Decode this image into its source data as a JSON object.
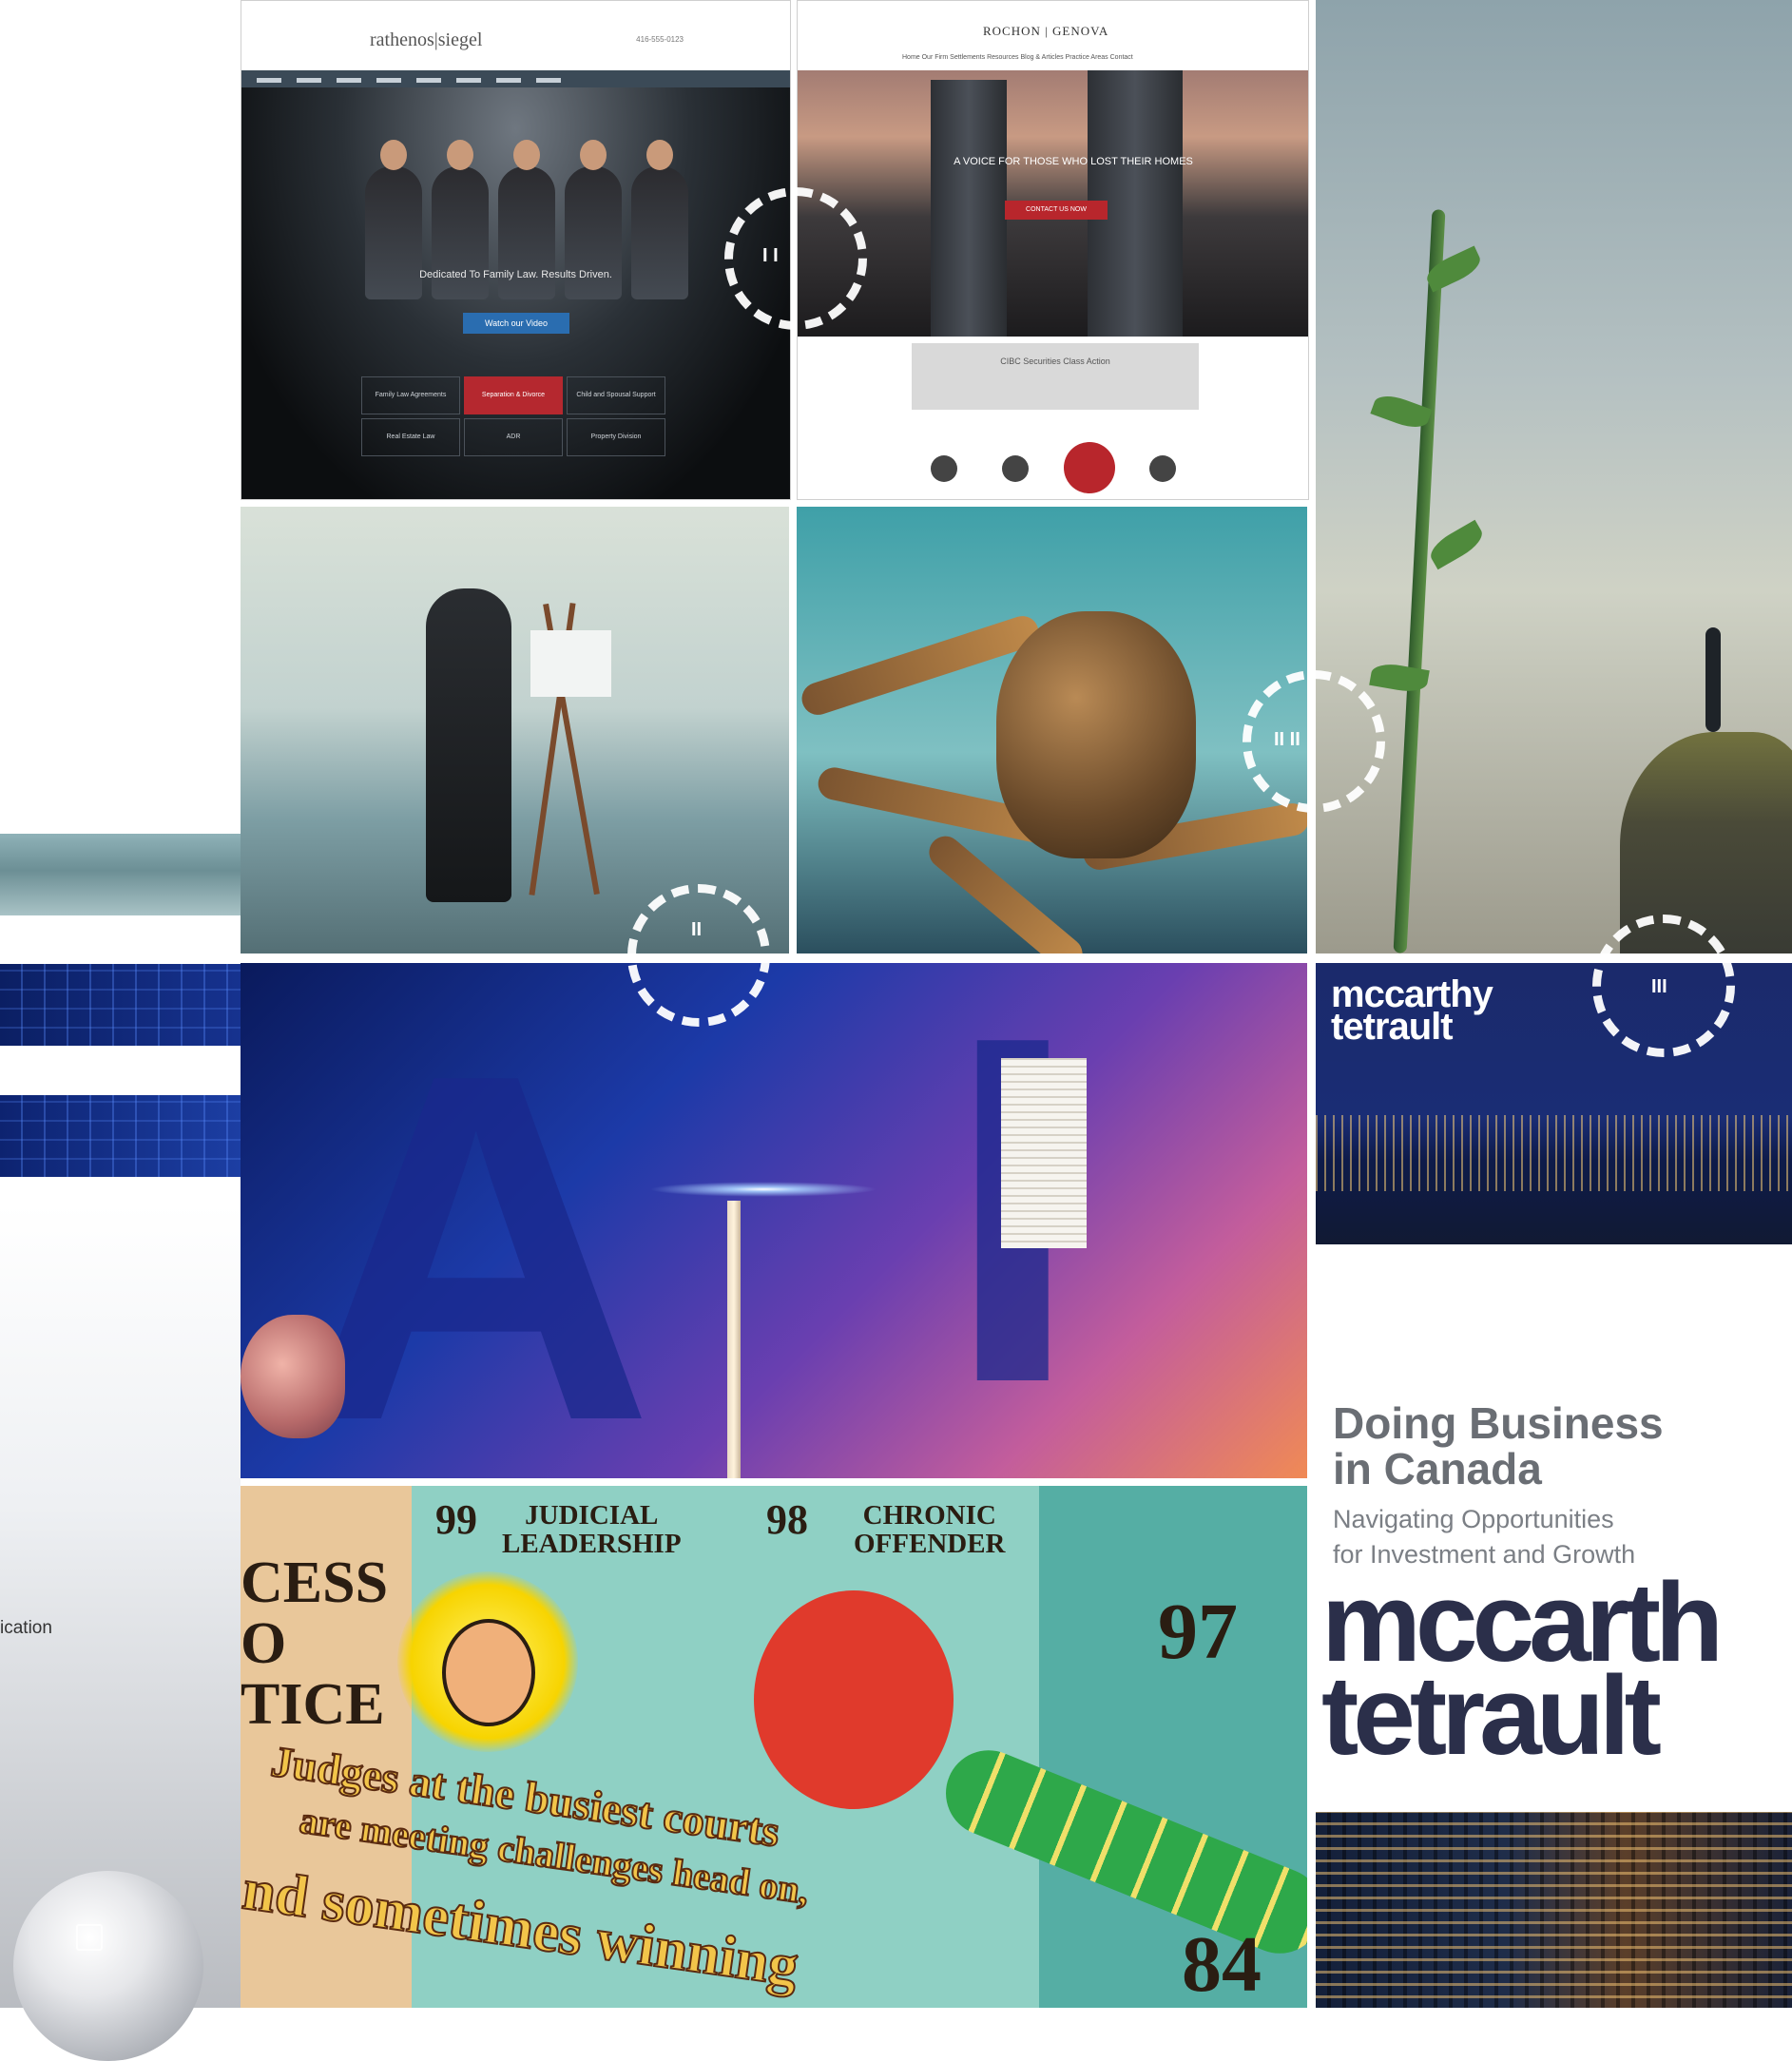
{
  "side_caption": "ication",
  "site_one": {
    "logo": "rathenos|siegel",
    "phone": "416-555-0123",
    "tagline": "Dedicated To Family Law. Results Driven.",
    "cta": "Watch our Video",
    "services": [
      "Family Law Agreements",
      "Separation & Divorce",
      "Child and Spousal Support",
      "Real Estate Law",
      "ADR",
      "Property Division"
    ]
  },
  "site_two": {
    "logo": "ROCHON | GENOVA",
    "nav": "Home  Our Firm  Settlements  Resources  Blog & Articles  Practice Areas  Contact",
    "heading": "A VOICE FOR THOSE WHO LOST THEIR HOMES",
    "cta": "CONTACT US NOW",
    "notice_title": "CIBC Securities Class Action"
  },
  "mccarthy": {
    "logo_line1": "mccarthy",
    "logo_line2": "tetrault"
  },
  "cover": {
    "title_line1": "Doing Business",
    "title_line2": "in Canada",
    "subtitle_line1": "Navigating Opportunities",
    "subtitle_line2": "for Investment and Growth",
    "logo_line1": "mccarth",
    "logo_line2": "tetrault"
  },
  "comic": {
    "access_lines": [
      "CESS",
      "O",
      "TICE"
    ],
    "num_99": "99",
    "label_99_line1": "JUDICIAL",
    "label_99_line2": "LEADERSHIP",
    "num_98": "98",
    "label_98_line1": "CHRONIC",
    "label_98_line2": "OFFENDER",
    "num_97": "97",
    "num_84": "84",
    "caption_line1": "Judges at the busiest courts",
    "caption_line2": "are meeting challenges head on,",
    "caption_line3": "nd sometimes winning"
  },
  "play_marks": {
    "one": "I    I",
    "two": "II",
    "three": "II    II",
    "four": "III"
  },
  "colors": {
    "accent_red": "#b5282f",
    "navy": "#1b2a6b"
  }
}
